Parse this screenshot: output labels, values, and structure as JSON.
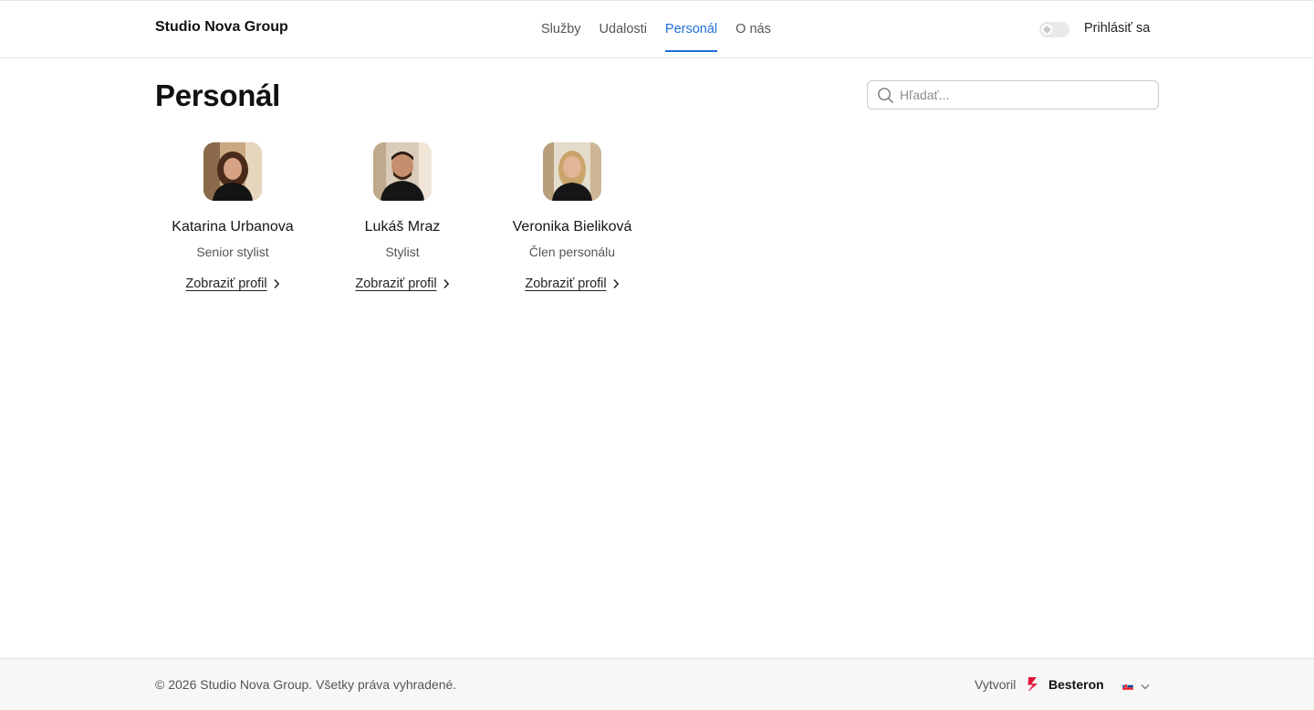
{
  "header": {
    "brand": "Studio Nova Group",
    "nav": [
      {
        "label": "Služby",
        "active": false
      },
      {
        "label": "Udalosti",
        "active": false
      },
      {
        "label": "Personál",
        "active": true
      },
      {
        "label": "O nás",
        "active": false
      }
    ],
    "theme_toggle_icon": "sun-icon",
    "login_label": "Prihlásiť sa"
  },
  "main": {
    "title": "Personál",
    "search": {
      "placeholder": "Hľadať...",
      "value": ""
    },
    "staff": [
      {
        "name": "Katarina Urbanova",
        "role": "Senior stylist",
        "link": "Zobraziť profil"
      },
      {
        "name": "Lukáš Mraz",
        "role": "Stylist",
        "link": "Zobraziť profil"
      },
      {
        "name": "Veronika Bieliková",
        "role": "Člen personálu",
        "link": "Zobraziť profil"
      }
    ]
  },
  "footer": {
    "copyright": "© 2026 Studio Nova Group. Všetky práva vyhradené.",
    "made_by_prefix": "Vytvoril",
    "made_by_brand": "Besteron",
    "language_flag_icon": "slovak-flag-icon"
  },
  "colors": {
    "accent": "#1e6fd9",
    "besteron_red": "#e3173e",
    "footer_bg": "#f7f7f7"
  }
}
